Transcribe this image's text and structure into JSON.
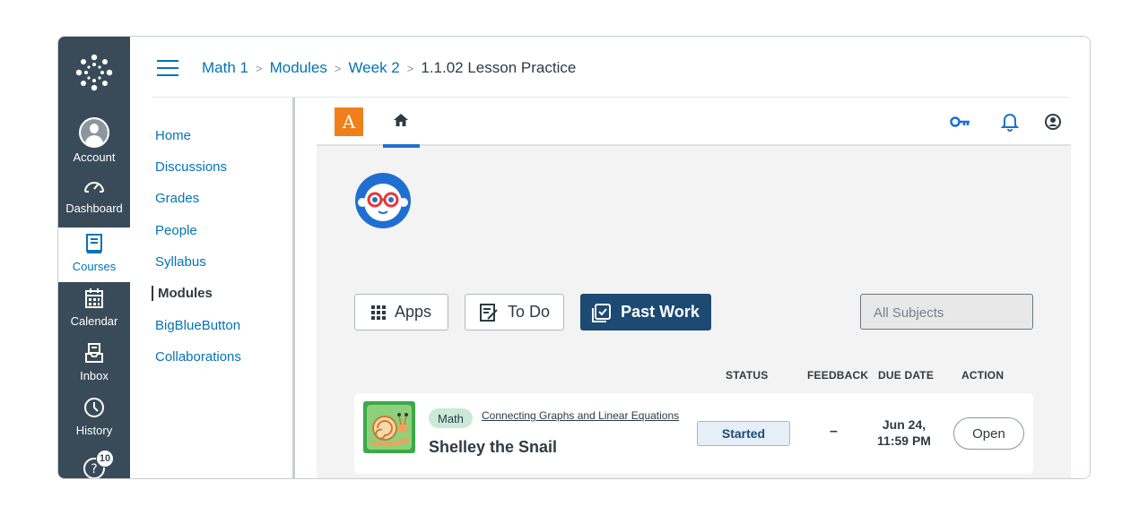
{
  "global_nav": {
    "items": [
      {
        "label": "Account",
        "icon": "user-avatar-icon"
      },
      {
        "label": "Dashboard",
        "icon": "dashboard-icon"
      },
      {
        "label": "Courses",
        "icon": "courses-book-icon"
      },
      {
        "label": "Calendar",
        "icon": "calendar-icon"
      },
      {
        "label": "Inbox",
        "icon": "inbox-icon"
      },
      {
        "label": "History",
        "icon": "clock-icon"
      }
    ],
    "help_badge": "10",
    "active": "Courses"
  },
  "breadcrumb": {
    "items": [
      "Math 1",
      "Modules",
      "Week 2"
    ],
    "current": "1.1.02 Lesson Practice",
    "separator": ">"
  },
  "course_nav": {
    "items": [
      "Home",
      "Discussions",
      "Grades",
      "People",
      "Syllabus",
      "Modules",
      "BigBlueButton",
      "Collaborations"
    ],
    "active": "Modules"
  },
  "app": {
    "logo_letter": "A",
    "tabs": {
      "apps": "Apps",
      "todo": "To Do",
      "past_work": "Past Work"
    },
    "subject_filter": "All Subjects",
    "columns": {
      "status": "STATUS",
      "feedback": "FEEDBACK",
      "due_date": "DUE DATE",
      "action": "ACTION"
    },
    "assignment": {
      "subject_tag": "Math",
      "lesson": "Connecting Graphs and Linear Equations",
      "title": "Shelley the Snail",
      "status": "Started",
      "feedback": "–",
      "due_line1": "Jun 24,",
      "due_line2": "11:59 PM",
      "action": "Open"
    }
  },
  "colors": {
    "global_nav_bg": "#394b58",
    "link_blue": "#0374b5",
    "past_work_bg": "#1c4a73",
    "logo_orange": "#f07f1b",
    "thumb_green": "#3da84c"
  }
}
